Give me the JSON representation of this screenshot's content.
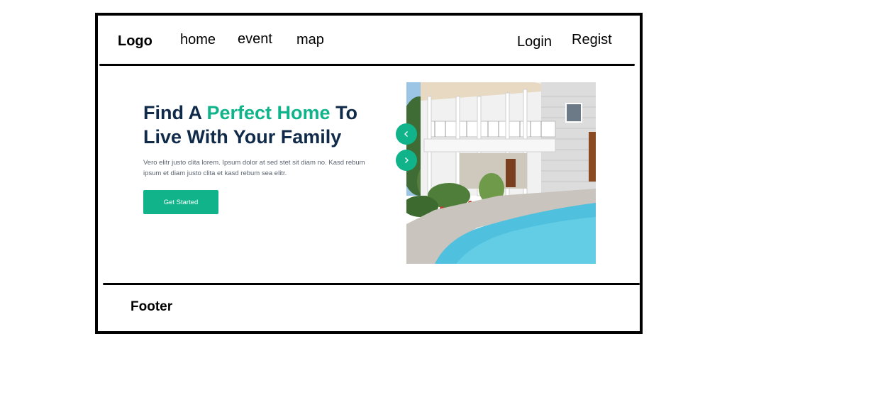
{
  "header": {
    "logo": "Logo",
    "nav": {
      "home": "home",
      "event": "event",
      "map": "map"
    },
    "auth": {
      "login": "Login",
      "register": "Regist"
    }
  },
  "hero": {
    "title_part1": "Find A ",
    "title_accent": "Perfect Home",
    "title_part2": " To Live With Your Family",
    "description": "Vero elitr justo clita lorem. Ipsum dolor at sed stet sit diam no. Kasd rebum ipsum et diam justo clita et kasd rebum sea elitr.",
    "cta_label": "Get Started",
    "image_alt": "house-with-pool",
    "slider_prev_icon": "chevron-left-icon",
    "slider_next_icon": "chevron-right-icon"
  },
  "footer": {
    "label": "Footer"
  },
  "colors": {
    "accent": "#11b48a",
    "heading": "#102a49",
    "body_text": "#5c6470",
    "border": "#000000"
  }
}
